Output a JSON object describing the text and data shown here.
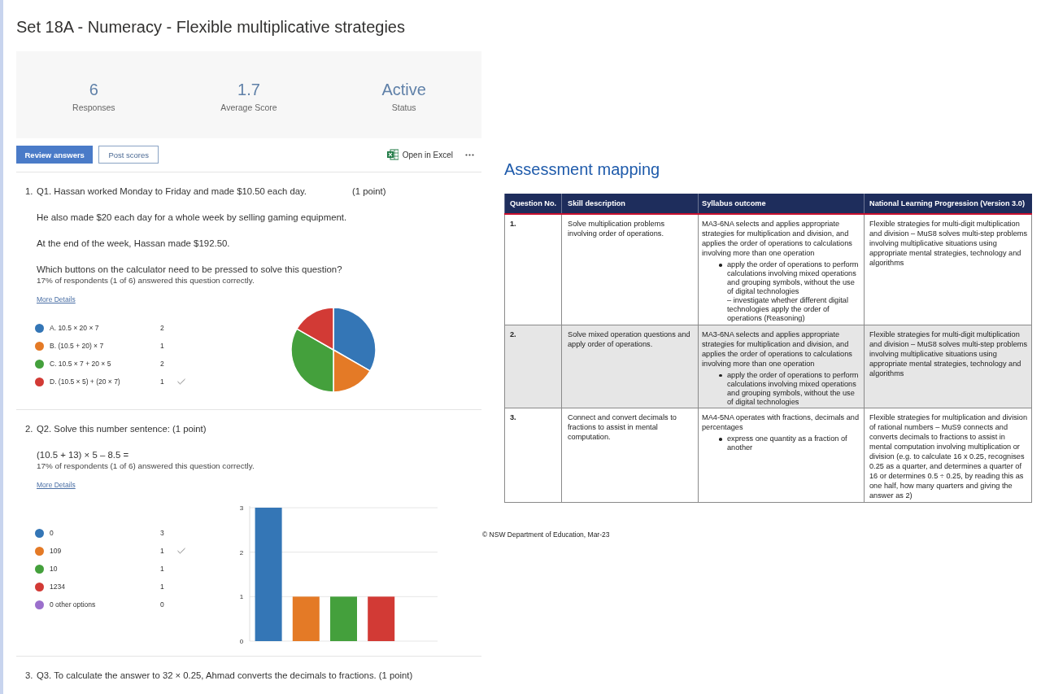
{
  "form": {
    "title": "Set 18A - Numeracy - Flexible multiplicative strategies",
    "stats": [
      {
        "value": "6",
        "label": "Responses"
      },
      {
        "value": "1.7",
        "label": "Average Score"
      },
      {
        "value": "Active",
        "label": "Status"
      }
    ],
    "actions": [
      {
        "label": "Review answers",
        "kind": "primary"
      },
      {
        "label": "Post scores",
        "kind": "outline"
      }
    ],
    "export": {
      "label": "Open in Excel"
    },
    "questions": [
      {
        "number": "1.",
        "title": "Q1. Hassan worked Monday to Friday and made $10.50 each day.",
        "points": "(1 point)",
        "body": [
          "He also made $20 each day for a whole week by selling gaming equipment.",
          "At the end of the week, Hassan made $192.50.",
          "Which buttons on the calculator need to be pressed to solve this question?"
        ],
        "result": "17% of respondents (1 of 6) answered this question correctly.",
        "details_link": "More Details",
        "options": [
          {
            "label": "A. 10.5 × 20 × 7",
            "count": "2",
            "correct": false,
            "color": "#3476b6"
          },
          {
            "label": "B. (10.5 + 20) × 7",
            "count": "1",
            "correct": false,
            "color": "#e47a26"
          },
          {
            "label": "C. 10.5 × 7 + 20 × 5",
            "count": "2",
            "correct": false,
            "color": "#44a03c"
          },
          {
            "label": "D. (10.5 × 5) + (20 × 7)",
            "count": "1",
            "correct": true,
            "color": "#d23a35"
          }
        ],
        "chart_data": {
          "type": "pie",
          "values": [
            33.3,
            16.7,
            33.3,
            16.7
          ]
        }
      },
      {
        "number": "2.",
        "title": "Q2. Solve this number sentence: (1 point)",
        "body": [
          "(10.5 + 13) × 5 – 8.5 ="
        ],
        "result": "17% of respondents (1 of 6) answered this question correctly.",
        "details_link": "More Details",
        "options": [
          {
            "label": "0",
            "count": "3",
            "correct": false,
            "color": "#3476b6"
          },
          {
            "label": "109",
            "count": "1",
            "correct": true,
            "color": "#e47a26"
          },
          {
            "label": "10",
            "count": "1",
            "correct": false,
            "color": "#44a03c"
          },
          {
            "label": "1234",
            "count": "1",
            "correct": false,
            "color": "#d23a35"
          },
          {
            "label": "0 other options",
            "count": "0",
            "correct": false,
            "color": "#9b6fcc"
          }
        ],
        "chart_data": {
          "type": "bar",
          "values": [
            3,
            1,
            1,
            1,
            0
          ],
          "ylim": [
            0,
            3
          ],
          "yticks": [
            0,
            1,
            2,
            3
          ]
        }
      },
      {
        "number": "3.",
        "title": "Q3. To calculate the answer to 32 × 0.25, Ahmad converts the decimals to fractions. (1 point)"
      }
    ]
  },
  "mapping": {
    "heading": "Assessment mapping",
    "table": {
      "columns": [
        "Question No.",
        "Skill description",
        "Syllabus outcome",
        "National Learning Progression (Version 3.0)"
      ],
      "rows": [
        {
          "question": "1.",
          "skill": "Solve multiplication problems involving order of operations.",
          "outcome": {
            "text": "MA3-6NA selects and applies appropriate strategies for multiplication and division, and applies the order of operations to calculations involving more than one operation",
            "bullets": [
              {
                "text": "apply the order of operations to perform calculations involving mixed operations and grouping symbols, without the use of digital technologies",
                "note": "– investigate whether different digital technologies apply the order of operations (Reasoning)"
              }
            ]
          },
          "progression": "Flexible strategies for multi-digit multiplication and division – MuS8 solves multi-step problems involving multiplicative situations using appropriate mental strategies, technology and algorithms"
        },
        {
          "question": "2.",
          "skill": "Solve mixed operation questions and apply order of operations.",
          "outcome": {
            "text": "MA3-6NA selects and applies appropriate strategies for multiplication and division, and applies the order of operations to calculations involving more than one operation",
            "bullets": [
              {
                "text": "apply the order of operations to perform calculations involving mixed operations and grouping symbols, without the use of digital technologies"
              }
            ]
          },
          "progression": "Flexible strategies for multi-digit multiplication and division – MuS8 solves multi-step problems involving multiplicative situations using appropriate mental strategies, technology and algorithms"
        },
        {
          "question": "3.",
          "skill": "Connect and convert decimals to fractions to assist in mental computation.",
          "outcome": {
            "text": "MA4-5NA operates with fractions, decimals and percentages",
            "bullets": [
              {
                "text": "express one quantity as a fraction of another"
              }
            ]
          },
          "progression": "Flexible strategies for multiplication and division of rational numbers – MuS9 connects and converts decimals to fractions to assist in mental computation involving multiplication or division (e.g. to calculate 16 x 0.25, recognises 0.25 as a quarter, and determines a quarter of 16 or determines 0.5 ÷ 0.25, by reading this as one half, how many quarters and giving the answer as 2)"
        }
      ]
    },
    "footer": "© NSW Department of Education, Mar-23"
  }
}
